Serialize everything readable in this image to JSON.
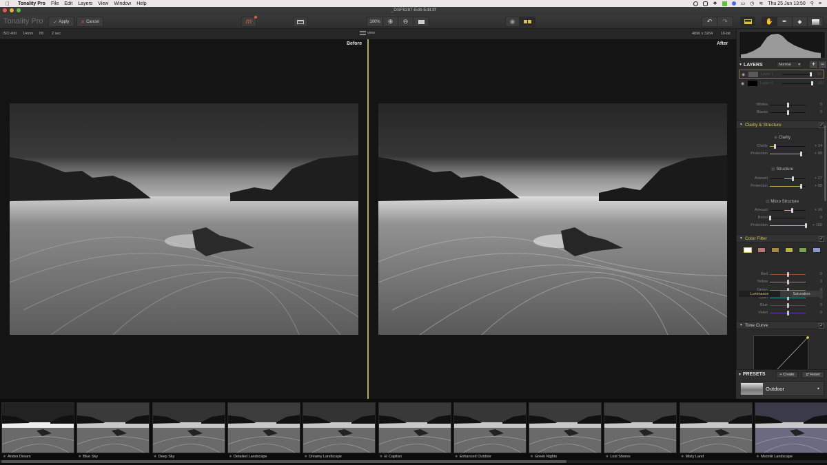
{
  "menubar": {
    "app_name": "Tonality Pro",
    "items": [
      "File",
      "Edit",
      "Layers",
      "View",
      "Window",
      "Help"
    ],
    "clock": "Thu 25 Jun  13:50"
  },
  "window": {
    "title": "_DSF6287-Edit-Edit.tif"
  },
  "toolbar": {
    "brand": "Tonality Pro",
    "apply_label": "Apply",
    "cancel_label": "Cancel",
    "logo_letter": "m",
    "zoom_label": "100%",
    "view_label": "view"
  },
  "info": {
    "iso": "ISO 400",
    "focal": "14mm",
    "aperture": "f/8",
    "shutter": "2 sec",
    "dimensions": "4896 x 3264",
    "bitdepth": "16-bit"
  },
  "canvas": {
    "before_label": "Before",
    "after_label": "After"
  },
  "layers": {
    "title": "LAYERS",
    "blend_mode": "Normal",
    "items": [
      {
        "name": "Layer 1",
        "value": "93",
        "level": 0.93
      },
      {
        "name": "Layer 0",
        "value": "100",
        "level": 1.0
      }
    ]
  },
  "tone": {
    "rows": [
      {
        "name": "Whites",
        "value": "0",
        "level": 0.5
      },
      {
        "name": "Blacks",
        "value": "0",
        "level": 0.5
      }
    ]
  },
  "clarity_structure": {
    "title": "Clarity & Structure",
    "clarity": {
      "title": "Clarity",
      "rows": [
        {
          "name": "Clarity",
          "value": "+ 14",
          "level": 0.14
        },
        {
          "name": "Protection",
          "value": "+ 88",
          "level": 0.88
        }
      ]
    },
    "structure": {
      "title": "Structure",
      "rows": [
        {
          "name": "Amount",
          "value": "+ 27",
          "level": 0.635
        },
        {
          "name": "Protection",
          "value": "+ 88",
          "level": 0.88
        }
      ]
    },
    "micro": {
      "title": "Micro Structure",
      "rows": [
        {
          "name": "Amount",
          "value": "+ 26",
          "level": 0.63
        },
        {
          "name": "Boost",
          "value": "0",
          "level": 0.0
        },
        {
          "name": "Protection",
          "value": "+ 100",
          "level": 1.0
        }
      ]
    }
  },
  "color_filter": {
    "title": "Color Filter",
    "swatches": [
      "#ffffff",
      "#b57a72",
      "#a5894a",
      "#b7b44a",
      "#7aa05a",
      "#8a9cc8"
    ],
    "tabs": [
      "Luminance",
      "Saturation"
    ],
    "active_tab": "Luminance",
    "rows": [
      {
        "name": "Red",
        "value": "0",
        "level": 0.5,
        "color": "#a8503a"
      },
      {
        "name": "Yellow",
        "value": "0",
        "level": 0.5,
        "color": "#a8a03a"
      },
      {
        "name": "Green",
        "value": "0",
        "level": 0.5,
        "color": "#5aa03a"
      },
      {
        "name": "Cyan",
        "value": "0",
        "level": 0.5,
        "color": "#3aa8a0"
      },
      {
        "name": "Blue",
        "value": "0",
        "level": 0.5,
        "color": "#3a48b0"
      },
      {
        "name": "Violet",
        "value": "0",
        "level": 0.5,
        "color": "#6a3ab0"
      }
    ]
  },
  "tone_curve": {
    "title": "Tone Curve"
  },
  "presets": {
    "title": "PRESETS",
    "create_label": "Create",
    "reset_label": "Reset",
    "current": "Outdoor"
  },
  "filmstrip": {
    "items": [
      "Andes Dream",
      "Blue Sky",
      "Deep Sky",
      "Detailed Landscape",
      "Dreamy Landscape",
      "El Capitan",
      "Enhanced Outdoor",
      "Greek Nights",
      "Lost Shores",
      "Misty Land",
      "Moonlit Landscape"
    ]
  }
}
